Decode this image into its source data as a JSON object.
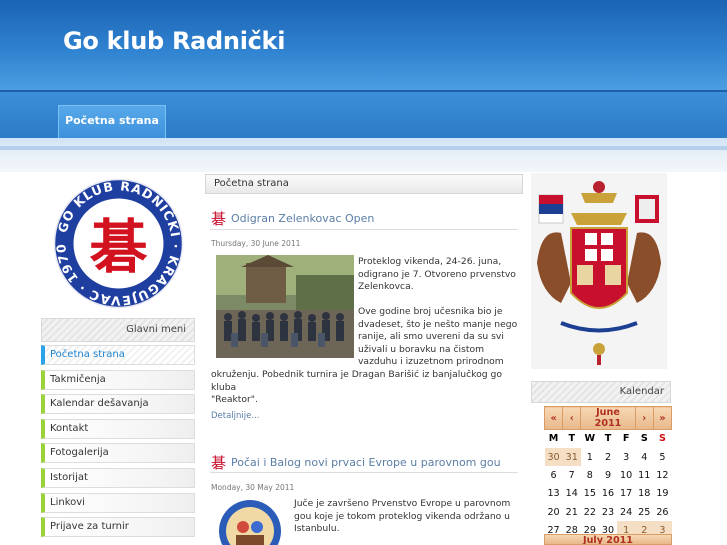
{
  "site": {
    "title": "Go klub Radnički"
  },
  "nav": {
    "items": [
      {
        "label": "Početna strana"
      }
    ]
  },
  "sidebar": {
    "menu_title": "Glavni meni",
    "logo_text": "GO KLUB RADNIČKI · KRAGUJEVAC · 1970",
    "items": [
      {
        "label": "Početna strana"
      },
      {
        "label": "Takmičenja"
      },
      {
        "label": "Kalendar dešavanja"
      },
      {
        "label": "Kontakt"
      },
      {
        "label": "Fotogalerija"
      },
      {
        "label": "Istorijat"
      },
      {
        "label": "Linkovi"
      },
      {
        "label": "Prijave za turnir"
      }
    ]
  },
  "main": {
    "breadcrumb": "Početna strana",
    "articles": [
      {
        "title": "Odigran Zelenkovac Open",
        "date": "Thursday, 30 June 2011",
        "p1_lines": [
          "Proteklog vikenda, 24-26. juna,",
          "odigrano je 7. Otvoreno prvenstvo",
          "Zelenkovca."
        ],
        "p2_lines": [
          "Ove godine broj učesnika bio je",
          "dvadeset, što je nešto manje nego",
          "ranije, ali smo uvereni da su svi",
          "uživali u boravku na čistom",
          "vazduhu i izuzetnom prirodnom"
        ],
        "p2_tail": "okruženju. Pobednik turnira je Dragan Barišić iz banjalučkog go kluba",
        "p2_tail2": "\"Reaktor\".",
        "more": "Detaljnije..."
      },
      {
        "title": "Počai i Balog novi prvaci Evrope u parovnom gou",
        "date": "Monday, 30 May 2011",
        "lines": [
          "Juče je završeno Prvenstvo Evrope u parovnom",
          "gou koje je tokom proteklog vikenda održano u",
          "Istanbulu."
        ]
      }
    ]
  },
  "calendar": {
    "title": "Kalendar",
    "month_label": "June 2011",
    "prev_labels": [
      "«",
      "‹"
    ],
    "next_labels": [
      "›",
      "»"
    ],
    "dow": [
      "M",
      "T",
      "W",
      "T",
      "F",
      "S",
      "S"
    ],
    "weeks": [
      [
        "30",
        "31",
        "1",
        "2",
        "3",
        "4",
        "5"
      ],
      [
        "6",
        "7",
        "8",
        "9",
        "10",
        "11",
        "12"
      ],
      [
        "13",
        "14",
        "15",
        "16",
        "17",
        "18",
        "19"
      ],
      [
        "20",
        "21",
        "22",
        "23",
        "24",
        "25",
        "26"
      ],
      [
        "27",
        "28",
        "29",
        "30",
        "1",
        "2",
        "3"
      ]
    ],
    "next_month_label": "July 2011",
    "colors": {
      "header": "#e8b88a",
      "sunday": "#d01010"
    }
  }
}
